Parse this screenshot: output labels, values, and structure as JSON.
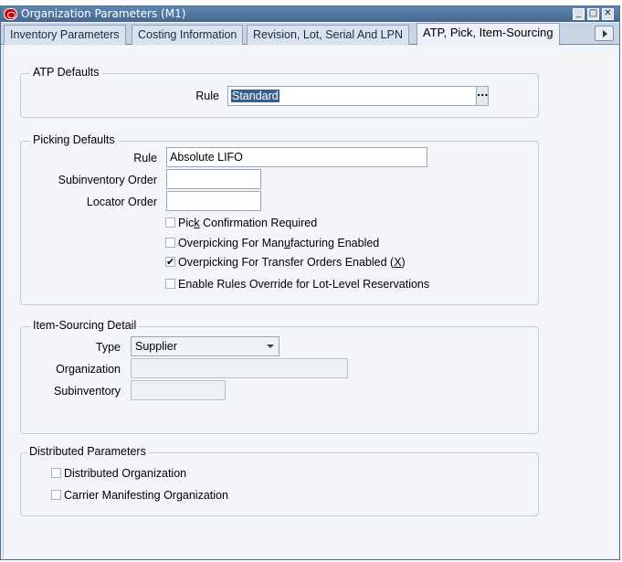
{
  "window": {
    "title": "Organization Parameters (M1)",
    "controls": [
      "_",
      "□",
      "✕"
    ]
  },
  "tabs": [
    {
      "label": "Inventory Parameters",
      "active": false
    },
    {
      "label": "Costing Information",
      "active": false
    },
    {
      "label": "Revision, Lot, Serial And LPN",
      "active": false
    },
    {
      "label": "ATP, Pick, Item-Sourcing",
      "active": true
    }
  ],
  "atp": {
    "legend": "ATP Defaults",
    "rule_label": "Rule",
    "rule_value": "Standard",
    "lov_label": "..."
  },
  "picking": {
    "legend": "Picking Defaults",
    "rule_label": "Rule",
    "rule_value": "Absolute LIFO",
    "subinventory_label": "Subinventory Order",
    "subinventory_value": "",
    "locator_label": "Locator Order",
    "locator_value": "",
    "checks": [
      {
        "pre": "Pic",
        "u": "k",
        "post": " Confirmation Required",
        "checked": false
      },
      {
        "pre": "Overpicking For Man",
        "u": "u",
        "post": "facturing Enabled",
        "checked": false
      },
      {
        "pre": "Overpicking For Transfer Orders Enabled (",
        "u": "X",
        "post": ")",
        "checked": true
      },
      {
        "pre": "Enable Rules Override for Lot-Level Reservations",
        "u": "",
        "post": "",
        "checked": false
      }
    ]
  },
  "sourcing": {
    "legend": "Item-Sourcing Detail",
    "type_label": "Type",
    "type_value": "Supplier",
    "organization_label": "Organization",
    "organization_value": "",
    "subinventory_label": "Subinventory",
    "subinventory_value": ""
  },
  "distributed": {
    "legend": "Distributed Parameters",
    "checks": [
      {
        "label": "Distributed Organization",
        "checked": false
      },
      {
        "label": "Carrier Manifesting Organization",
        "checked": false
      }
    ]
  }
}
